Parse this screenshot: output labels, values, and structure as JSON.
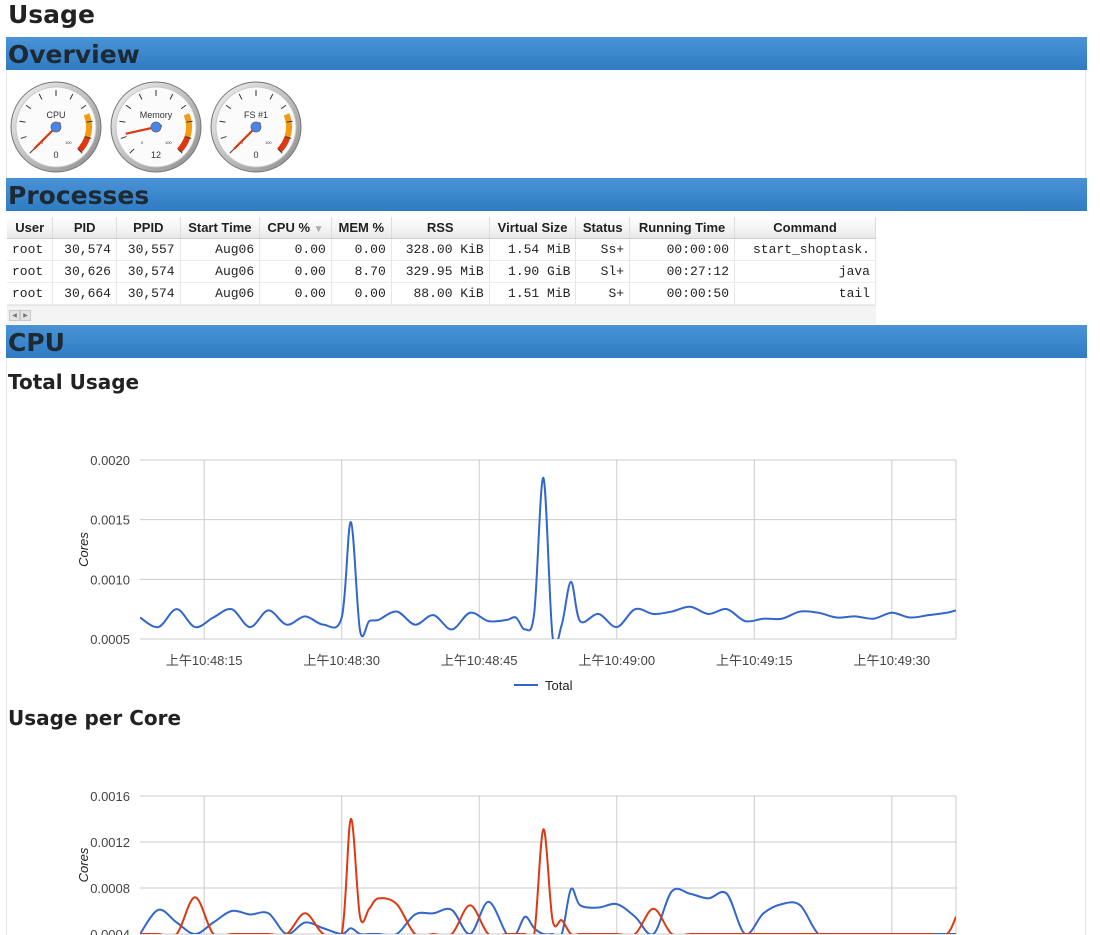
{
  "page": {
    "title": "Usage"
  },
  "sections": {
    "overview": "Overview",
    "processes": "Processes",
    "cpu": "CPU"
  },
  "gauges": [
    {
      "label": "CPU",
      "value": 0,
      "display": "0"
    },
    {
      "label": "Memory",
      "value": 12,
      "display": "12"
    },
    {
      "label": "FS #1",
      "value": 0,
      "display": "0"
    }
  ],
  "gauge_scale": {
    "min": "0",
    "max": "100"
  },
  "processes": {
    "headers": [
      "User",
      "PID",
      "PPID",
      "Start Time",
      "CPU %",
      "MEM %",
      "RSS",
      "Virtual Size",
      "Status",
      "Running Time",
      "Command"
    ],
    "sort_indicator": "▼",
    "rows": [
      [
        "root",
        "30,574",
        "30,557",
        "Aug06",
        "0.00",
        "0.00",
        "328.00 KiB",
        "1.54 MiB",
        "Ss+",
        "00:00:00",
        "start_shoptask."
      ],
      [
        "root",
        "30,626",
        "30,574",
        "Aug06",
        "0.00",
        "8.70",
        "329.95 MiB",
        "1.90 GiB",
        "Sl+",
        "00:27:12",
        "java"
      ],
      [
        "root",
        "30,664",
        "30,574",
        "Aug06",
        "0.00",
        "0.00",
        "88.00 KiB",
        "1.51 MiB",
        "S+",
        "00:00:50",
        "tail"
      ]
    ]
  },
  "charts": {
    "total_title": "Total Usage",
    "per_core_title": "Usage per Core"
  },
  "chart_data": [
    {
      "type": "line",
      "title": "Total Usage",
      "ylabel": "Cores",
      "xlabel": "",
      "ylim": [
        0.0005,
        0.002
      ],
      "yticks": [
        "0.0020",
        "0.0015",
        "0.0010",
        "0.0005"
      ],
      "xticks": [
        "上午10:48:15",
        "上午10:48:30",
        "上午10:48:45",
        "上午10:49:00",
        "上午10:49:15",
        "上午10:49:30"
      ],
      "legend": "bottom",
      "grid": true,
      "colors": {
        "Total": "#3366cc"
      },
      "x_seconds": [
        8,
        10,
        12,
        14,
        16,
        18,
        20,
        22,
        24,
        26,
        28,
        30,
        31,
        32,
        33,
        34,
        36,
        38,
        40,
        42,
        44,
        46,
        48,
        49,
        50,
        51,
        52,
        53,
        54,
        55,
        56,
        58,
        60,
        62,
        64,
        66,
        68,
        70,
        72,
        74,
        76,
        78,
        80,
        82,
        84,
        86,
        88,
        90,
        92,
        94,
        96,
        97
      ],
      "series": [
        {
          "name": "Total",
          "values": [
            0.00068,
            0.0006,
            0.00075,
            0.0006,
            0.00068,
            0.00075,
            0.0006,
            0.00074,
            0.00062,
            0.00069,
            0.00062,
            0.00068,
            0.00148,
            0.00057,
            0.00065,
            0.00066,
            0.00073,
            0.00062,
            0.0007,
            0.00058,
            0.00072,
            0.00065,
            0.00066,
            0.00068,
            0.00058,
            0.00072,
            0.00185,
            0.00052,
            0.00062,
            0.00098,
            0.00065,
            0.00071,
            0.0006,
            0.00075,
            0.00071,
            0.00073,
            0.00077,
            0.00071,
            0.00075,
            0.00065,
            0.00067,
            0.00067,
            0.00073,
            0.00072,
            0.00068,
            0.00069,
            0.00067,
            0.00072,
            0.00068,
            0.0007,
            0.00072,
            0.00074
          ]
        }
      ]
    },
    {
      "type": "line",
      "title": "Usage per Core",
      "ylabel": "Cores",
      "xlabel": "",
      "ylim": [
        0.0004,
        0.0016
      ],
      "yticks": [
        "0.0016",
        "0.0012",
        "0.0008",
        "0.0004"
      ],
      "legend": "none",
      "grid": true,
      "colors": {
        "core0": "#3366cc",
        "core1": "#dc3912"
      },
      "x_seconds": [
        8,
        10,
        12,
        14,
        16,
        18,
        20,
        22,
        24,
        26,
        28,
        30,
        31,
        32,
        33,
        34,
        36,
        38,
        40,
        42,
        44,
        46,
        48,
        49,
        50,
        51,
        52,
        53,
        54,
        55,
        56,
        58,
        60,
        62,
        64,
        66,
        68,
        70,
        72,
        74,
        76,
        78,
        80,
        82,
        84,
        86,
        88,
        90,
        92,
        94,
        96,
        97
      ],
      "series": [
        {
          "values": [
            0.0004,
            0.00061,
            0.0005,
            0.0004,
            0.0005,
            0.0006,
            0.00057,
            0.00058,
            0.0004,
            0.0005,
            0.00045,
            0.0004,
            0.00045,
            0.0004,
            0.0004,
            0.0004,
            0.0004,
            0.00057,
            0.00058,
            0.00061,
            0.0004,
            0.00068,
            0.0004,
            0.0004,
            0.00055,
            0.00045,
            0.0004,
            0.0004,
            0.0004,
            0.00079,
            0.00065,
            0.00063,
            0.00066,
            0.00055,
            0.0004,
            0.00077,
            0.00075,
            0.00071,
            0.00075,
            0.0004,
            0.00058,
            0.00066,
            0.00065,
            0.0004,
            0.0004,
            0.0004,
            0.0004,
            0.0004,
            0.0004,
            0.0004,
            0.0004,
            0.0004
          ]
        },
        {
          "values": [
            0.0004,
            0.0004,
            0.0004,
            0.00072,
            0.0004,
            0.0004,
            0.0004,
            0.0004,
            0.0004,
            0.00058,
            0.0004,
            0.0004,
            0.0014,
            0.00055,
            0.00062,
            0.00071,
            0.00066,
            0.0004,
            0.0004,
            0.0004,
            0.00065,
            0.0004,
            0.0004,
            0.0004,
            0.0004,
            0.0004,
            0.00131,
            0.00052,
            0.00052,
            0.0004,
            0.0004,
            0.0004,
            0.0004,
            0.0004,
            0.00062,
            0.0004,
            0.0004,
            0.0004,
            0.0004,
            0.0004,
            0.0004,
            0.0004,
            0.0004,
            0.0004,
            0.0004,
            0.0004,
            0.0004,
            0.0004,
            0.0004,
            0.0004,
            0.0004,
            0.00055
          ]
        }
      ]
    }
  ]
}
